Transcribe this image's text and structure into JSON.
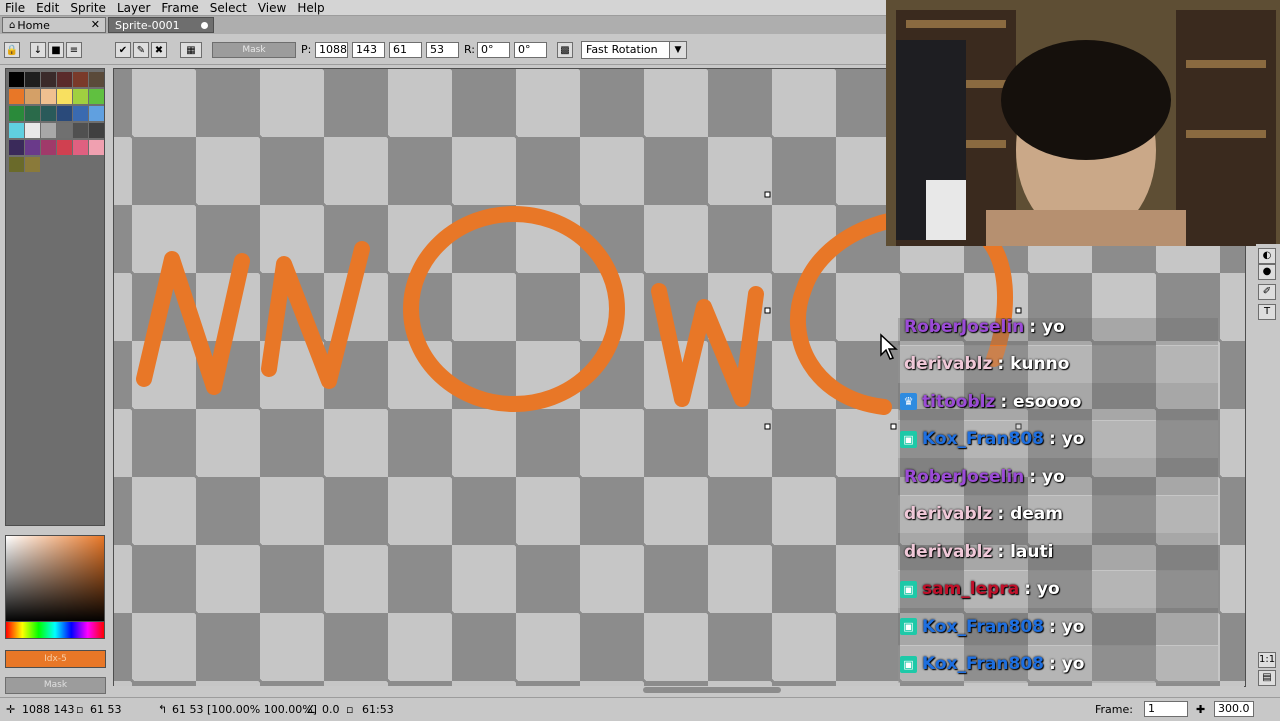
{
  "menu": [
    "File",
    "Edit",
    "Sprite",
    "Layer",
    "Frame",
    "Select",
    "View",
    "Help"
  ],
  "tabs": {
    "home": "Home",
    "sprite": "Sprite-0001"
  },
  "toolbar": {
    "mask_label": "Mask",
    "p_label": "P:",
    "x": "1088",
    "y": "143",
    "w": "61",
    "h": "53",
    "r_label": "R:",
    "r1": "0°",
    "r2": "0°",
    "rotation_mode": "Fast Rotation"
  },
  "left": {
    "idx_label": "Idx-5",
    "mask_label": "Mask"
  },
  "palette": [
    "#000000",
    "#1e1e1e",
    "#3a2a2a",
    "#5a2a2a",
    "#7a3a2a",
    "#5a4a3a",
    "#e87727",
    "#d4a067",
    "#f0c090",
    "#f8e060",
    "#a0d040",
    "#60c040",
    "#2a8a3a",
    "#2a6a4a",
    "#2a5a5a",
    "#2a4a7a",
    "#3a6ab0",
    "#60a0e0",
    "#60d0e0",
    "#e8e8e8",
    "#a8a8a8",
    "#707070",
    "#505050",
    "#404040",
    "#3a2a5a",
    "#6a3a8a",
    "#a03a6a",
    "#d04050",
    "#e06080",
    "#f0a0b0",
    "#6a6a2a",
    "#8a7a3a"
  ],
  "status": {
    "cursor": "1088 143",
    "size": "61 53",
    "transform": "61 53 [100.00% 100.00%]",
    "angle": "0.0",
    "dims": "61:53",
    "frame_label": "Frame:",
    "frame_value": "1",
    "zoom": "300.0"
  },
  "chat": [
    {
      "user": "RoberJoselin",
      "text": ": yo",
      "color": "#9b4bd6",
      "badge": ""
    },
    {
      "user": "derivablz",
      "text": ": kunno",
      "color": "#f0c8d8",
      "badge": ""
    },
    {
      "user": "titooblz",
      "text": ": esoooo",
      "color": "#9b4bd6",
      "badge": "prime"
    },
    {
      "user": "Kox_Fran808",
      "text": ": yo",
      "color": "#1e6fe0",
      "badge": "gift"
    },
    {
      "user": "RoberJoselin",
      "text": ": yo",
      "color": "#9b4bd6",
      "badge": ""
    },
    {
      "user": "derivablz",
      "text": ": deam",
      "color": "#f0c8d8",
      "badge": ""
    },
    {
      "user": "derivablz",
      "text": ": lauti",
      "color": "#f0c8d8",
      "badge": ""
    },
    {
      "user": "sam_lepra",
      "text": ": yo",
      "color": "#c0102a",
      "badge": "gift"
    },
    {
      "user": "Kox_Fran808",
      "text": ": yo",
      "color": "#1e6fe0",
      "badge": "gift"
    },
    {
      "user": "Kox_Fran808",
      "text": ": yo",
      "color": "#1e6fe0",
      "badge": "gift"
    }
  ],
  "colors": {
    "brush": "#e87727",
    "chat_stripe": "rgba(120,120,120,0.55)"
  }
}
